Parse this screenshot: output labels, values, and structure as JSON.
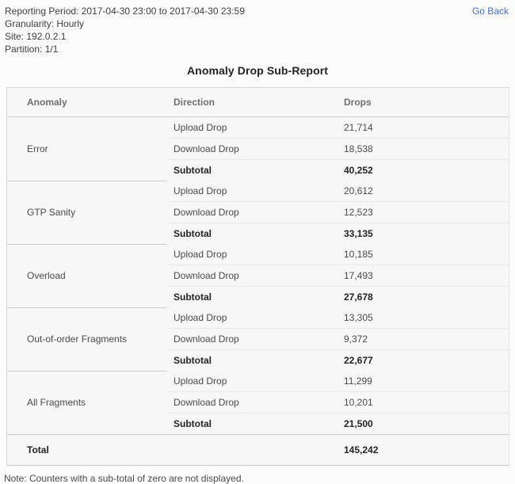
{
  "header": {
    "reporting_period_label": "Reporting Period: 2017-04-30 23:00 to 2017-04-30 23:59",
    "granularity_label": "Granularity: Hourly",
    "site_label": "Site: 192.0.2.1",
    "partition_label": "Partition: 1/1",
    "go_back_label": "Go Back",
    "link_color": "#3a6fd8"
  },
  "report": {
    "title": "Anomaly Drop Sub-Report",
    "columns": {
      "anomaly": "Anomaly",
      "direction": "Direction",
      "drops": "Drops"
    },
    "groups": [
      {
        "name": "Error",
        "rows": [
          {
            "direction": "Upload Drop",
            "drops": "21,714"
          },
          {
            "direction": "Download Drop",
            "drops": "18,538"
          }
        ],
        "subtotal_label": "Subtotal",
        "subtotal": "40,252"
      },
      {
        "name": "GTP Sanity",
        "rows": [
          {
            "direction": "Upload Drop",
            "drops": "20,612"
          },
          {
            "direction": "Download Drop",
            "drops": "12,523"
          }
        ],
        "subtotal_label": "Subtotal",
        "subtotal": "33,135"
      },
      {
        "name": "Overload",
        "rows": [
          {
            "direction": "Upload Drop",
            "drops": "10,185"
          },
          {
            "direction": "Download Drop",
            "drops": "17,493"
          }
        ],
        "subtotal_label": "Subtotal",
        "subtotal": "27,678"
      },
      {
        "name": "Out-of-order Fragments",
        "rows": [
          {
            "direction": "Upload Drop",
            "drops": "13,305"
          },
          {
            "direction": "Download Drop",
            "drops": "9,372"
          }
        ],
        "subtotal_label": "Subtotal",
        "subtotal": "22,677"
      },
      {
        "name": "All Fragments",
        "rows": [
          {
            "direction": "Upload Drop",
            "drops": "11,299"
          },
          {
            "direction": "Download Drop",
            "drops": "10,201"
          }
        ],
        "subtotal_label": "Subtotal",
        "subtotal": "21,500"
      }
    ],
    "total_label": "Total",
    "total": "145,242"
  },
  "footer": {
    "note": "Note: Counters with a sub-total of zero are not displayed."
  }
}
